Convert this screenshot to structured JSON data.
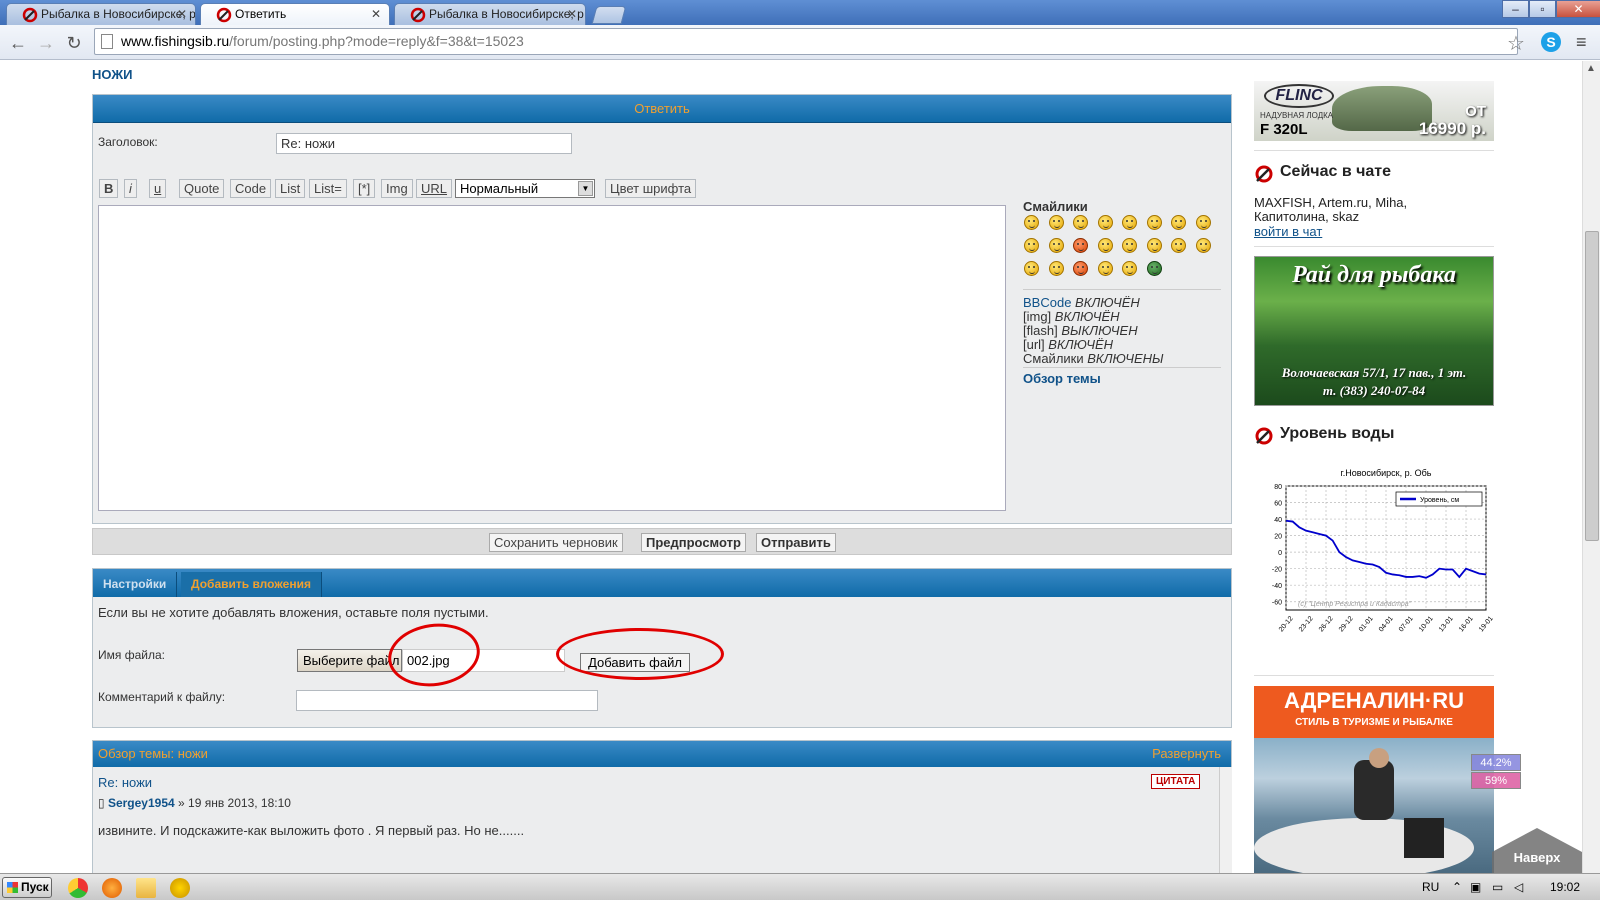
{
  "browser": {
    "tabs": [
      {
        "title": "Рыбалка в Новосибирске, р",
        "active": false
      },
      {
        "title": "Ответить",
        "active": true
      },
      {
        "title": "Рыбалка в Новосибирске, р",
        "active": false
      }
    ],
    "close_glyph": "✕",
    "window_controls": {
      "minimize": "–",
      "maximize": "▫",
      "close": "✕"
    },
    "address": {
      "host": "www.fishingsib.ru",
      "path": "/forum/posting.php?mode=reply&f=38&t=15023"
    },
    "nav": {
      "back": "←",
      "forward": "→",
      "reload": "↻"
    },
    "star": "☆",
    "skype_letter": "S",
    "menu_glyph": "≡"
  },
  "breadcrumb": "НОЖИ",
  "post_form": {
    "header": "Ответить",
    "subject_label": "Заголовок:",
    "subject_value": "Re: ножи",
    "bbcode_buttons": [
      "B",
      "i",
      "u",
      "Quote",
      "Code",
      "List",
      "List=",
      "[*]",
      "Img",
      "URL"
    ],
    "font_size_select": "Нормальный",
    "font_color_button": "Цвет шрифта",
    "smilies_title": "Смайлики",
    "options": [
      {
        "key": "BBCode",
        "value": "ВКЛЮЧЁН",
        "linked": true
      },
      {
        "key": "[img]",
        "value": "ВКЛЮЧЁН",
        "linked": false
      },
      {
        "key": "[flash]",
        "value": "ВЫКЛЮЧЕН",
        "linked": false
      },
      {
        "key": "[url]",
        "value": "ВКЛЮЧЁН",
        "linked": false
      },
      {
        "key": "Смайлики",
        "value": "ВКЛЮЧЕНЫ",
        "linked": false
      }
    ],
    "topic_review_link": "Обзор темы"
  },
  "submit_bar": {
    "save_draft": "Сохранить черновик",
    "preview": "Предпросмотр",
    "submit": "Отправить"
  },
  "attachments": {
    "tabs": [
      "Настройки",
      "Добавить вложения"
    ],
    "active_tab": 1,
    "note": "Если вы не хотите добавлять вложения, оставьте поля пустыми.",
    "filename_label": "Имя файла:",
    "choose_file_button": "Выберите файл",
    "chosen_file": "002.jpg",
    "add_file_button": "Добавить файл",
    "comment_label": "Комментарий к файлу:"
  },
  "topic_review": {
    "header": "Обзор темы: ножи",
    "expand": "Развернуть",
    "post_title": "Re: ножи",
    "author": "Sergey1954",
    "date": "» 19 янв 2013, 18:10",
    "quote_button": "ЦИТАТА",
    "text": "извините. И подскажите-как выложить фото . Я первый раз. Но не......."
  },
  "sidebar": {
    "ad_flinc": {
      "logo": "FLINC",
      "subtitle": "НАДУВНАЯ ЛОДКА",
      "model": "F 320L",
      "from": "ОТ",
      "price": "16990 р."
    },
    "chat": {
      "title": "Сейчас в чате",
      "names": "MAXFISH, Artem.ru, Miha, Капитолина, skaz",
      "link": "войти в чат"
    },
    "ad_paradise": {
      "title": "Рай для рыбака",
      "address_line1": "Волочаевская 57/1, 17 пав., 1 эт.",
      "address_line2": "т. (383) 240-07-84"
    },
    "water_level": {
      "title": "Уровень воды"
    },
    "ad_adrenalin": {
      "brand": "АДРЕНАЛИН·RU",
      "tagline": "СТИЛЬ В ТУРИЗМЕ И РЫБАЛКЕ"
    },
    "scroll_up": "Наверх",
    "percent_overlays": [
      "44.2%",
      "59%"
    ]
  },
  "chart_data": {
    "type": "line",
    "title": "г.Новосибирск, р. Обь",
    "xlabel": "",
    "ylabel": "",
    "ylim": [
      -70,
      80
    ],
    "yticks": [
      80,
      60,
      40,
      20,
      0,
      -20,
      -40,
      -60
    ],
    "categories": [
      "20-12",
      "21-12",
      "22-12",
      "23-12",
      "24-12",
      "25-12",
      "26-12",
      "27-12",
      "28-12",
      "29-12",
      "30-12",
      "31-12",
      "01-01",
      "02-01",
      "03-01",
      "04-01",
      "05-01",
      "06-01",
      "07-01",
      "08-01",
      "09-01",
      "10-01",
      "11-01",
      "12-01",
      "13-01",
      "14-01",
      "15-01",
      "16-01",
      "17-01",
      "18-01",
      "19-01"
    ],
    "tick_labels": [
      "20-12",
      "23-12",
      "26-12",
      "29-12",
      "01-01",
      "04-01",
      "07-01",
      "10-01",
      "13-01",
      "16-01",
      "19-01"
    ],
    "series": [
      {
        "name": "Уровень, см",
        "color": "#0000cc",
        "values": [
          38,
          37,
          30,
          26,
          24,
          22,
          20,
          14,
          0,
          -6,
          -10,
          -12,
          -14,
          -15,
          -18,
          -25,
          -27,
          -28,
          -30,
          -30,
          -29,
          -31,
          -27,
          -20,
          -21,
          -21,
          -30,
          -20,
          -23,
          -26,
          -27
        ]
      }
    ],
    "watermark": "(c) \"Центр Регистра и Кадастра\"",
    "grid": true,
    "legend": "top-right"
  },
  "taskbar": {
    "start": "Пуск",
    "lang": "RU",
    "clock": "19:02"
  },
  "colors": {
    "accent_blue": "#106ba8",
    "link": "#105289",
    "header_text": "#f0a030",
    "annotation_red": "#e00000"
  }
}
